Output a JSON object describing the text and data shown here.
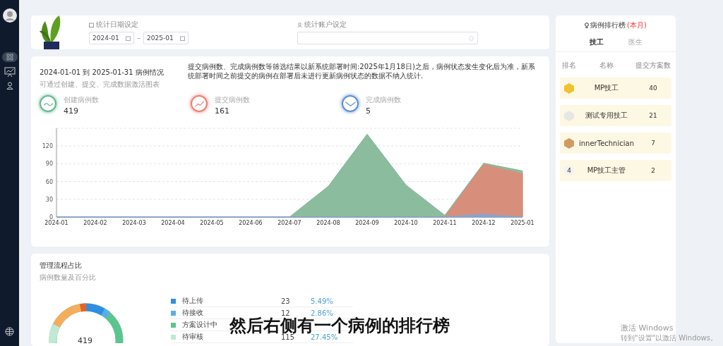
{
  "filters": {
    "date_label": "统计日期设定",
    "date_start": "2024-01",
    "date_end": "2025-01",
    "account_label": "统计账户设定"
  },
  "overview": {
    "title": "2024-01-01 到 2025-01-31 病例情况",
    "subtitle": "可通过创建、提交、完成数据激活图表",
    "note": "提交病例数、完成病例数等筛选结果以新系统部署时间:2025年1月18日)之后，病例状态发生变化后为准，新系统部署时间之前提交的病例在部署后未进行更新病例状态的数据不纳入统计.",
    "stats": [
      {
        "kind": "created",
        "label": "创建病例数",
        "value": "419",
        "color": "#5fb88a"
      },
      {
        "kind": "submitted",
        "label": "提交病例数",
        "value": "161",
        "color": "#ee7d72"
      },
      {
        "kind": "completed",
        "label": "完成病例数",
        "value": "5",
        "color": "#5b8fd0"
      }
    ],
    "chart_data": {
      "type": "area",
      "categories": [
        "2024-01",
        "2024-02",
        "2024-03",
        "2024-04",
        "2024-05",
        "2024-06",
        "2024-07",
        "2024-08",
        "2024-09",
        "2024-10",
        "2024-11",
        "2024-12",
        "2025-01"
      ],
      "ylim": [
        0,
        150
      ],
      "yticks": [
        0,
        30,
        60,
        90,
        120
      ],
      "stacked": false,
      "grid": true,
      "series": [
        {
          "color": "#7fb594",
          "values": [
            0,
            0,
            0,
            0,
            0,
            0,
            0,
            52,
            140,
            54,
            3,
            91,
            78
          ]
        },
        {
          "color": "#df8a78",
          "values": [
            0,
            0,
            0,
            0,
            0,
            0,
            0,
            0,
            0,
            0,
            0,
            89,
            73
          ]
        },
        {
          "color": "#8aa3d6",
          "values": [
            0,
            0,
            0,
            0,
            0,
            0,
            0,
            0,
            0,
            0,
            0,
            5,
            0
          ]
        }
      ]
    }
  },
  "process": {
    "title": "管理流程占比",
    "subtitle": "病例数量及百分比",
    "total": "419",
    "legend": [
      {
        "label": "待上传",
        "count": "23",
        "percent": "5.49%",
        "color": "#2f8ee0"
      },
      {
        "label": "待接收",
        "count": "12",
        "percent": "2.86%",
        "color": "#5aaee8"
      },
      {
        "label": "方案设计中",
        "color": "#5cc48e"
      },
      {
        "label": "待审核",
        "count": "115",
        "percent": "27.45%",
        "color": "#bfe9d3"
      }
    ]
  },
  "ranking": {
    "title": "病例排行榜",
    "period": "(本月)",
    "tabs": [
      {
        "label": "技工",
        "selected": true
      },
      {
        "label": "医生",
        "selected": false
      }
    ],
    "columns": [
      "排名",
      "名称",
      "提交方案数"
    ],
    "rows": [
      {
        "kind": "gold",
        "name": "MP技工",
        "count": "40"
      },
      {
        "kind": "silver",
        "name": "测试专用技工",
        "count": "21"
      },
      {
        "kind": "bronze",
        "name": "innerTechnician",
        "count": "7"
      },
      {
        "kind": "number",
        "rank": "4",
        "name": "MP技工主管",
        "count": "2"
      }
    ]
  },
  "caption": "然后右侧有一个病例的排行榜",
  "activation": {
    "title": "激活 Windows",
    "hint": "转到\"设置\"以激活 Windows。"
  }
}
